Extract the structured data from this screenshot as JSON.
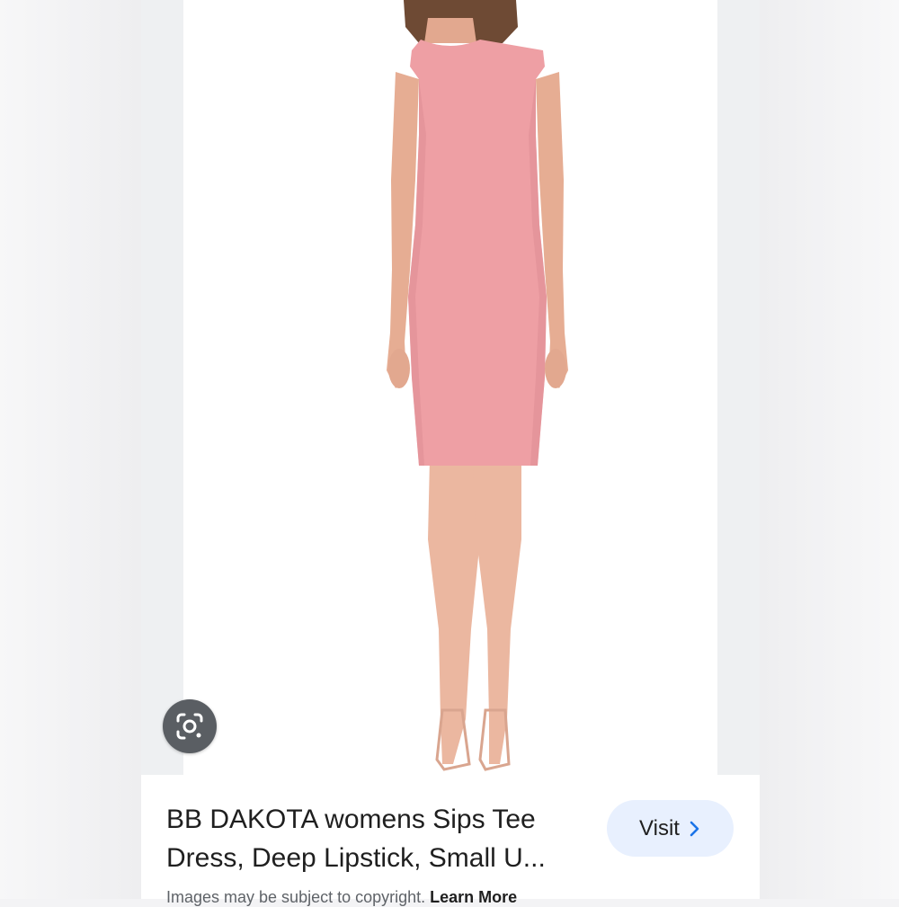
{
  "product": {
    "title_line1": "BB DAKOTA womens Sips Tee",
    "title_line2": "Dress, Deep Lipstick, Small U..."
  },
  "visit_button": {
    "label": "Visit",
    "icon": "chevron-right-icon"
  },
  "lens_button": {
    "icon": "google-lens-icon"
  },
  "copyright_notice": {
    "text": "Images may be subject to copyright.",
    "link": "Learn More"
  },
  "colors": {
    "dress": "#ee9fa4",
    "skin": "#e9b49c",
    "button_bg": "#e8f0fe",
    "chevron": "#1a73e8"
  }
}
